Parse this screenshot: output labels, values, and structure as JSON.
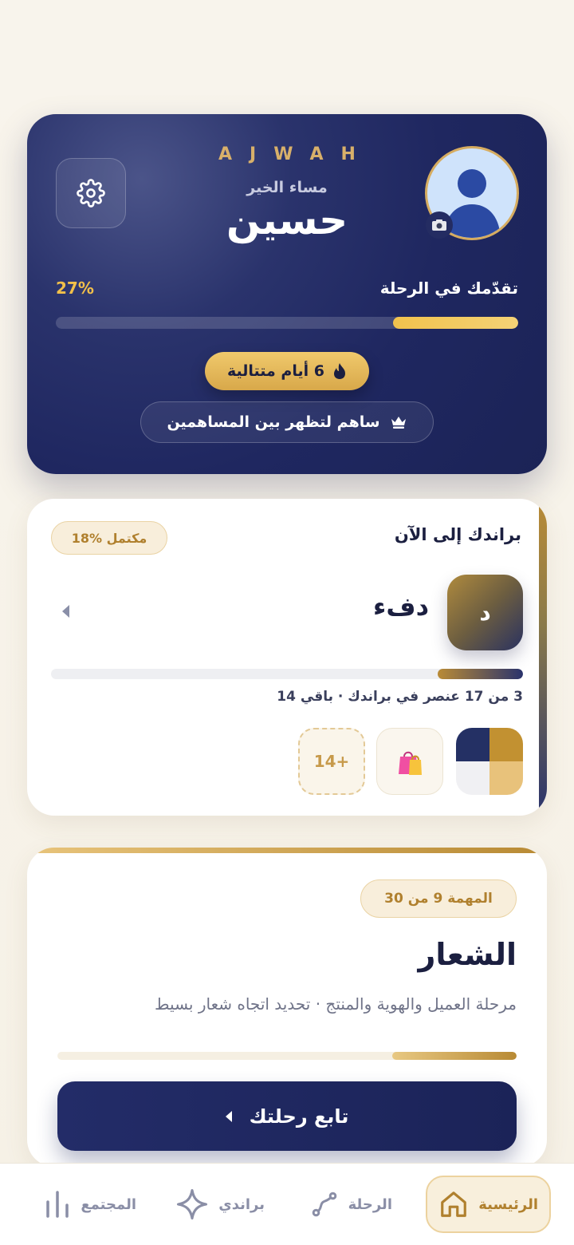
{
  "hero": {
    "brand": "AJWAH",
    "greeting": "مساء الخير",
    "username": "حسين",
    "progress_label": "تقدّمك في الرحلة",
    "progress_pct_text": "27%",
    "progress_value": 0.27,
    "streak_text": "6 أيام متتالية",
    "contributors_text": "ساهم لتظهر بين المساهمين"
  },
  "brand_card": {
    "title": "براندك إلى الآن",
    "complete_badge": "18% مكتمل",
    "tile_letter": "د",
    "brand_name": "دفء",
    "progress_value": 0.18,
    "meta": "3 من 17 عنصر في براندك · باقي 14",
    "more_count": "14+"
  },
  "task_card": {
    "badge": "المهمة 9 من 30",
    "title": "الشعار",
    "description": "مرحلة العميل والهوية والمنتج · تحديد اتجاه شعار بسيط",
    "progress_value": 0.27,
    "continue_label": "تابع رحلتك"
  },
  "nav": {
    "home": "الرئيسية",
    "journey": "الرحلة",
    "mybrand": "براندي",
    "community": "المجتمع"
  },
  "colors": {
    "navy": "#1f2760",
    "gold": "#d6ac60",
    "accent_yellow": "#f1c24d"
  }
}
